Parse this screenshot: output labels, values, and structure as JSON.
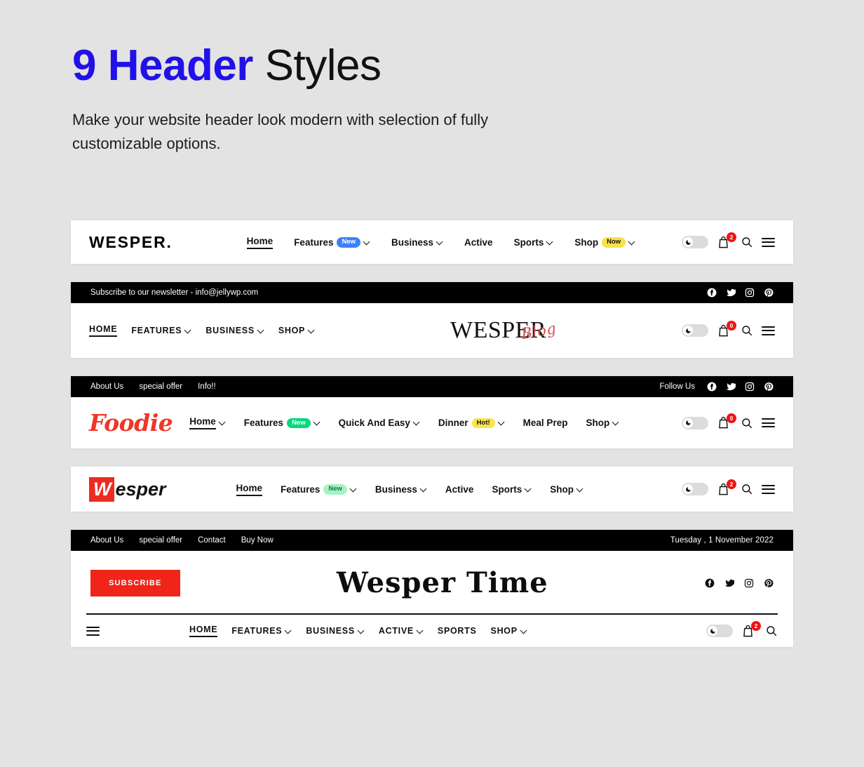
{
  "hero": {
    "title_accent": "9 Header",
    "title_rest": " Styles",
    "subtitle": "Make your website header look modern with selection of fully customizable options."
  },
  "colors": {
    "page_bg": "#e3e3e3",
    "accent_blue": "#2111e8",
    "badge_blue": "#3c82f6",
    "badge_yellow": "#f7e14a",
    "badge_green": "#00d97e",
    "cart_red": "#f01414",
    "brand_red": "#f02418"
  },
  "header1": {
    "logo": "WESPER.",
    "nav": [
      {
        "label": "Home",
        "active": true,
        "chevron": false,
        "badge": null
      },
      {
        "label": "Features",
        "active": false,
        "chevron": true,
        "badge": "New",
        "badge_style": "blue"
      },
      {
        "label": "Business",
        "active": false,
        "chevron": true,
        "badge": null
      },
      {
        "label": "Active",
        "active": false,
        "chevron": false,
        "badge": null
      },
      {
        "label": "Sports",
        "active": false,
        "chevron": true,
        "badge": null
      },
      {
        "label": "Shop",
        "active": false,
        "chevron": true,
        "badge": "Now",
        "badge_style": "yellow"
      }
    ],
    "cart_count": "2"
  },
  "header2": {
    "topbar_text": "Subscribe to our newsletter - info@jellywp.com",
    "socials": [
      "facebook-icon",
      "twitter-icon",
      "instagram-icon",
      "pinterest-icon"
    ],
    "logo": "WESPER",
    "logo_script": "Blog",
    "nav": [
      {
        "label": "HOME",
        "active": true,
        "chevron": false
      },
      {
        "label": "FEATURES",
        "active": false,
        "chevron": true
      },
      {
        "label": "BUSINESS",
        "active": false,
        "chevron": true
      },
      {
        "label": "SHOP",
        "active": false,
        "chevron": true
      }
    ],
    "cart_count": "0"
  },
  "header3": {
    "topbar_links": [
      "About Us",
      "special offer",
      "Info!!"
    ],
    "follow_label": "Follow Us",
    "socials": [
      "facebook-icon",
      "twitter-icon",
      "instagram-icon",
      "pinterest-icon"
    ],
    "logo": "Foodie",
    "nav": [
      {
        "label": "Home",
        "active": true,
        "chevron": true,
        "badge": null
      },
      {
        "label": "Features",
        "active": false,
        "chevron": true,
        "badge": "New",
        "badge_style": "green"
      },
      {
        "label": "Quick And Easy",
        "active": false,
        "chevron": true,
        "badge": null
      },
      {
        "label": "Dinner",
        "active": false,
        "chevron": true,
        "badge": "Hot!",
        "badge_style": "hot"
      },
      {
        "label": "Meal Prep",
        "active": false,
        "chevron": false,
        "badge": null
      },
      {
        "label": "Shop",
        "active": false,
        "chevron": true,
        "badge": null
      }
    ],
    "cart_count": "0"
  },
  "header4": {
    "logo_first": "W",
    "logo_rest": "esper",
    "nav": [
      {
        "label": "Home",
        "active": true,
        "chevron": false,
        "badge": null
      },
      {
        "label": "Features",
        "active": false,
        "chevron": true,
        "badge": "New",
        "badge_style": "greenl"
      },
      {
        "label": "Business",
        "active": false,
        "chevron": true,
        "badge": null
      },
      {
        "label": "Active",
        "active": false,
        "chevron": false,
        "badge": null
      },
      {
        "label": "Sports",
        "active": false,
        "chevron": true,
        "badge": null
      },
      {
        "label": "Shop",
        "active": false,
        "chevron": true,
        "badge": null
      }
    ],
    "cart_count": "2"
  },
  "header5": {
    "topbar_links": [
      "About Us",
      "special offer",
      "Contact",
      "Buy Now"
    ],
    "date": "Tuesday , 1 November 2022",
    "subscribe_label": "SUBSCRIBE",
    "logo": "Wesper Time",
    "socials": [
      "facebook-icon",
      "twitter-icon",
      "instagram-icon",
      "pinterest-icon"
    ],
    "nav": [
      {
        "label": "HOME",
        "active": true,
        "chevron": false
      },
      {
        "label": "FEATURES",
        "active": false,
        "chevron": true
      },
      {
        "label": "BUSINESS",
        "active": false,
        "chevron": true
      },
      {
        "label": "ACTIVE",
        "active": false,
        "chevron": true
      },
      {
        "label": "SPORTS",
        "active": false,
        "chevron": false
      },
      {
        "label": "SHOP",
        "active": false,
        "chevron": true
      }
    ],
    "cart_count": "2"
  }
}
